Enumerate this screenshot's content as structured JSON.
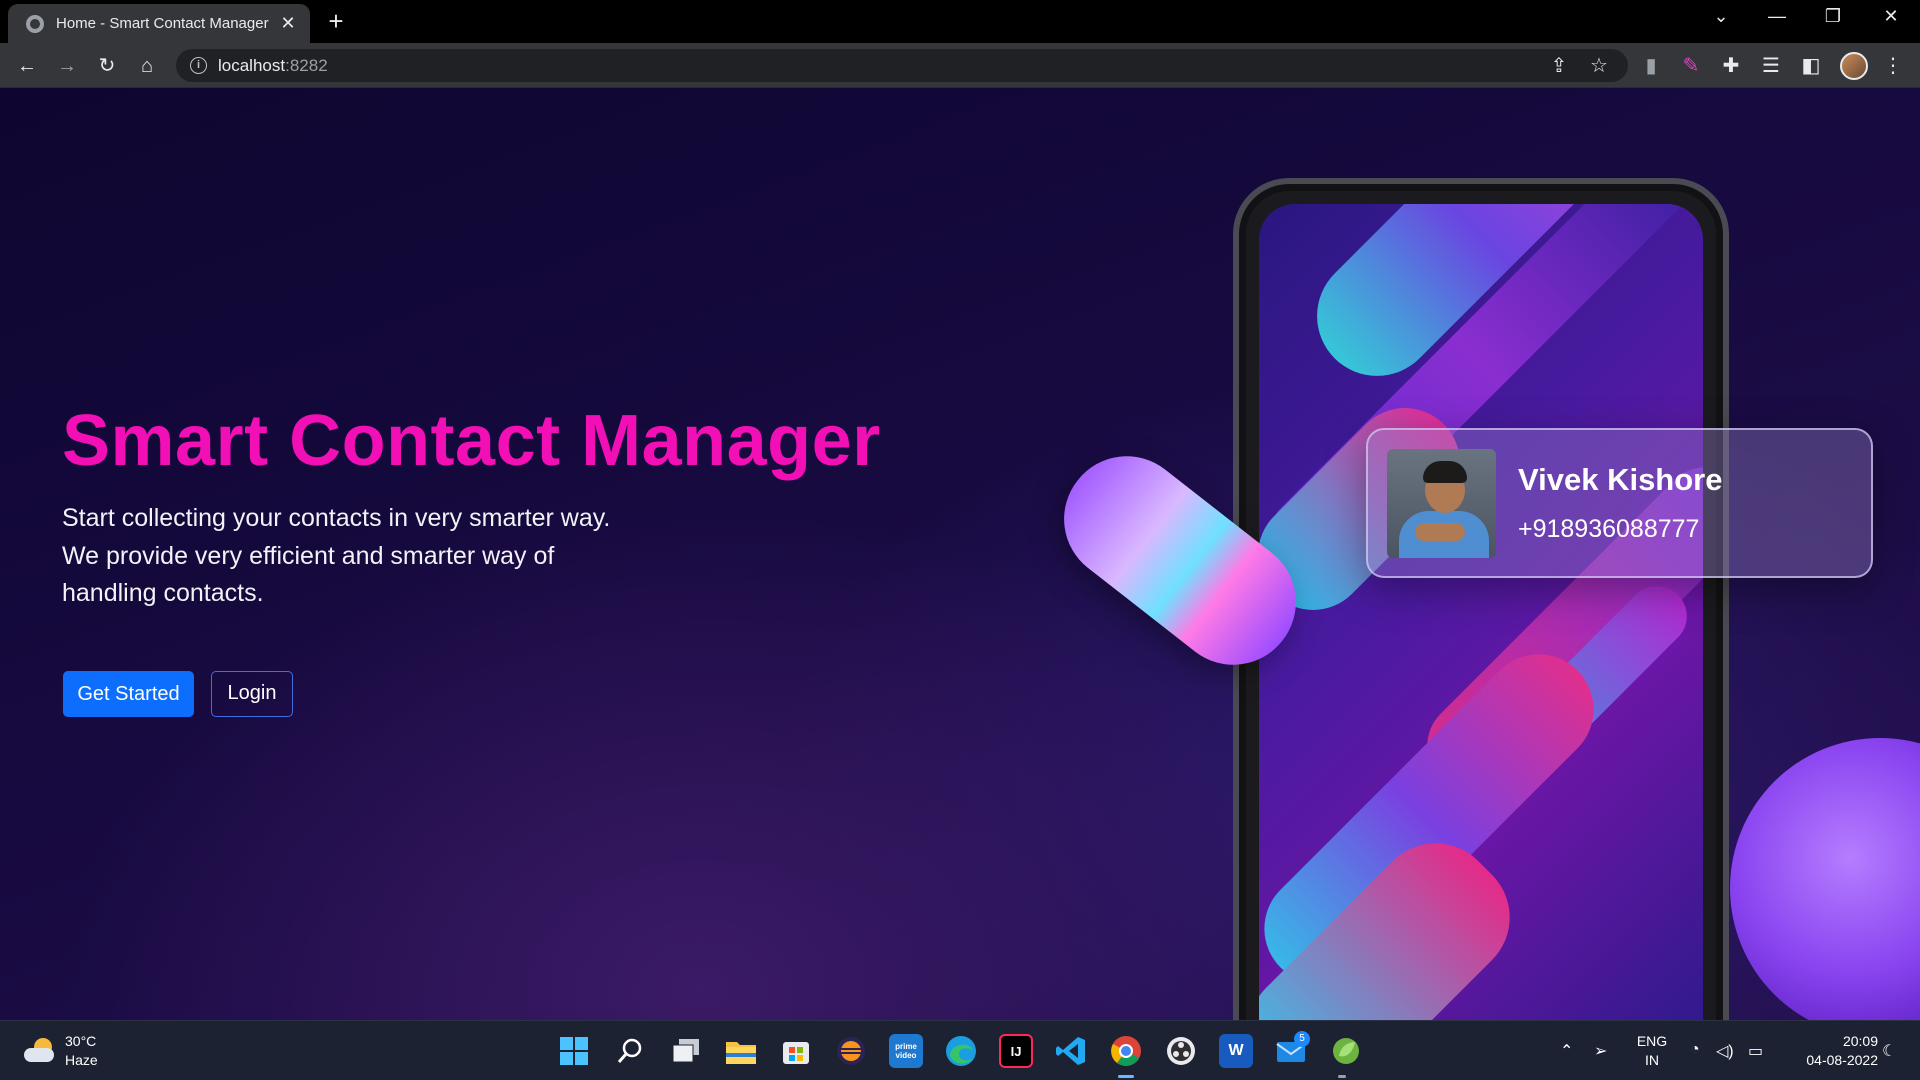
{
  "browser": {
    "tab_title": "Home - Smart Contact Manager",
    "tab_close_glyph": "✕",
    "new_tab_glyph": "+",
    "url_host": "localhost",
    "url_port": ":8282",
    "window_controls": {
      "chevron": "⌄",
      "minimize": "—",
      "restore": "❐",
      "close": "✕"
    },
    "toolbar_icons": [
      "back-icon",
      "forward-icon",
      "reload-icon",
      "home-icon",
      "share-icon",
      "bookmark-star-icon",
      "extension-dropper-icon",
      "extension-pen-icon",
      "extensions-puzzle-icon",
      "reading-list-icon",
      "side-panel-icon",
      "profile-avatar",
      "menu-kebab-icon"
    ]
  },
  "hero": {
    "title": "Smart Contact Manager",
    "line1": "Start collecting your contacts in very smarter way.",
    "line2": "We provide very efficient and smarter way of",
    "line3": "handling contacts.",
    "get_started_label": "Get Started",
    "login_label": "Login"
  },
  "card": {
    "name": "Vivek Kishore",
    "phone": "+918936088777"
  },
  "taskbar": {
    "weather_temp": "30°C",
    "weather_desc": "Haze",
    "apps": [
      "start",
      "search",
      "task-view",
      "file-explorer",
      "microsoft-store",
      "eclipse",
      "prime-video",
      "edge",
      "intellij",
      "vs-code",
      "chrome",
      "obs",
      "word",
      "mail",
      "spring-tool"
    ],
    "mail_badge": "5",
    "word_label": "W",
    "intellij_label": "IJ",
    "prime_label": "prime video",
    "lang_line1": "ENG",
    "lang_line2": "IN",
    "time": "20:09",
    "date": "04-08-2022"
  }
}
